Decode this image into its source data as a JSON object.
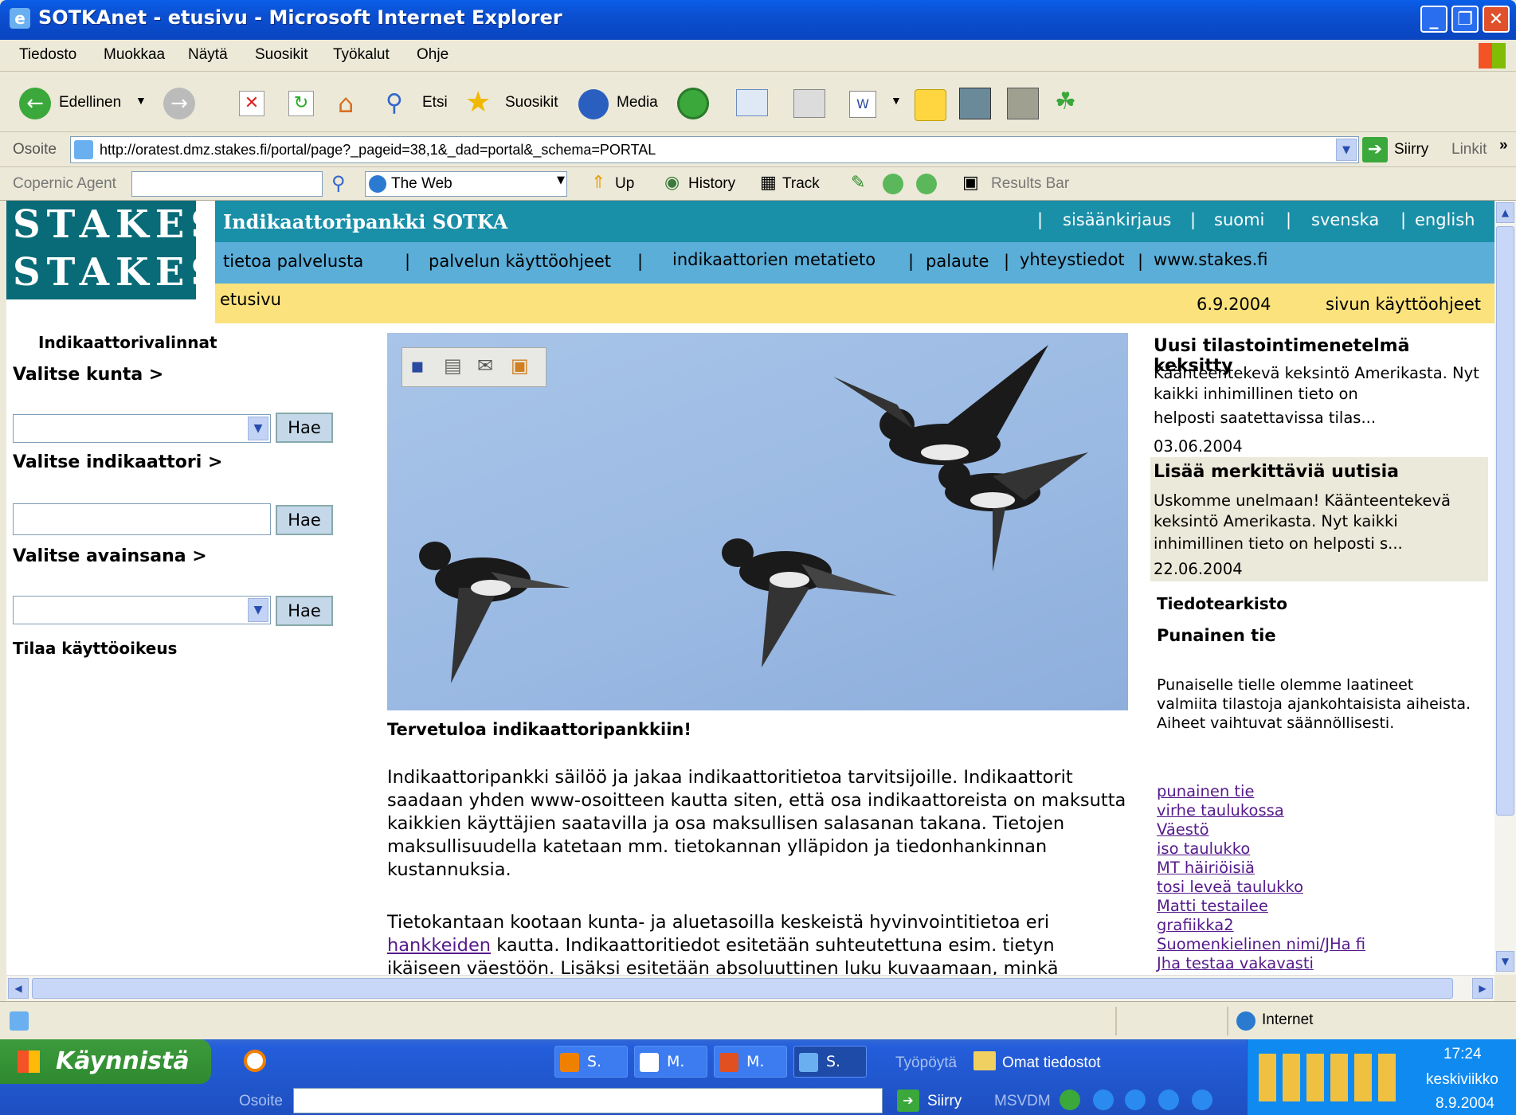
{
  "window": {
    "title": "SOTKAnet - etusivu - Microsoft Internet Explorer"
  },
  "menu": [
    "Tiedosto",
    "Muokkaa",
    "Näytä",
    "Suosikit",
    "Työkalut",
    "Ohje"
  ],
  "toolbar": {
    "back": "Edellinen",
    "search": "Etsi",
    "favorites": "Suosikit",
    "media": "Media"
  },
  "address": {
    "label": "Osoite",
    "url": "http://oratest.dmz.stakes.fi/portal/page?_pageid=38,1&_dad=portal&_schema=PORTAL",
    "go": "Siirry",
    "links": "Linkit"
  },
  "copernic": {
    "label": "Copernic Agent",
    "engine": "The Web",
    "up": "Up",
    "history": "History",
    "track": "Track",
    "results": "Results Bar"
  },
  "site": {
    "logo_text": "STAKES",
    "header_title": "Indikaattoripankki SOTKA",
    "top_links": [
      "sisäänkirjaus",
      "suomi",
      "svenska",
      "english"
    ],
    "nav_links": [
      "tietoa palvelusta",
      "palvelun käyttöohjeet",
      "indikaattorien metatieto",
      "palaute",
      "yhteystiedot",
      "www.stakes.fi"
    ],
    "breadcrumb": "etusivu",
    "date": "6.9.2004",
    "help": "sivun käyttöohjeet"
  },
  "left": {
    "title": "Indikaattorivalinnat",
    "kunta": "Valitse kunta >",
    "indikaattori": "Valitse indikaattori >",
    "avainsana": "Valitse avainsana >",
    "hae": "Hae",
    "tilaa": "Tilaa käyttöoikeus"
  },
  "main": {
    "welcome": "Tervetuloa indikaattoripankkiin!",
    "p1": "Indikaattoripankki säilöö ja jakaa indikaattoritietoa tarvitsijoille. Indikaattorit saadaan yhden www-osoitteen kautta siten, että osa indikaattoreista on maksutta kaikkien käyttäjien saatavilla ja osa maksullisen salasanan takana. Tietojen maksullisuudella katetaan mm. tietokannan ylläpidon ja tiedonhankinnan kustannuksia.",
    "p2_before": "Tietokantaan kootaan kunta- ja aluetasoilla keskeistä hyvinvointitietoa eri ",
    "p2_link": "hankkeiden",
    "p2_after": " kautta. Indikaattoritiedot esitetään suhteutettuna esim. tietyn ikäiseen väestöön. Lisäksi esitetään absoluuttinen luku kuvaamaan, minkä"
  },
  "news": [
    {
      "title": "Uusi tilastointimenetelmä keksitty",
      "body1": "Käänteentekevä keksintö Amerikasta. Nyt kaikki inhimillinen tieto on",
      "body2": "helposti saatettavissa tilas...",
      "date": "03.06.2004"
    },
    {
      "title": "Lisää merkittäviä uutisia",
      "body1": "Uskomme unelmaan! Käänteentekevä keksintö Amerikasta. Nyt kaikki",
      "body2": "inhimillinen tieto on helposti s...",
      "date": "22.06.2004"
    }
  ],
  "archive": {
    "title": "Tiedotearkisto",
    "subtitle": "Punainen tie",
    "text": "Punaiselle tielle olemme laatineet valmiita tilastoja ajankohtaisista aiheista. Aiheet vaihtuvat säännöllisesti.",
    "links": [
      "punainen tie",
      "virhe taulukossa",
      "Väestö",
      "iso taulukko",
      "MT häiriöisiä",
      "tosi leveä taulukko",
      "Matti testailee",
      "grafiikka2",
      "Suomenkielinen nimi/JHa fi",
      "Jha testaa vakavasti"
    ]
  },
  "status": {
    "zone": "Internet"
  },
  "taskbar": {
    "start": "Käynnistä",
    "buttons": [
      "S.",
      "M.",
      "M.",
      "S."
    ],
    "desktop": "Työpöytä",
    "mydocs": "Omat tiedostot",
    "address": "Osoite",
    "go": "Siirry",
    "msvdm": "MSVDM",
    "time": "17:24",
    "day": "keskiviikko",
    "date": "8.9.2004"
  },
  "colors": {
    "header_dark": "#1a8fa8",
    "header_light": "#5aaed8",
    "breadcrumb_bg": "#fbe27c",
    "logo_bg": "#0a6b78"
  }
}
